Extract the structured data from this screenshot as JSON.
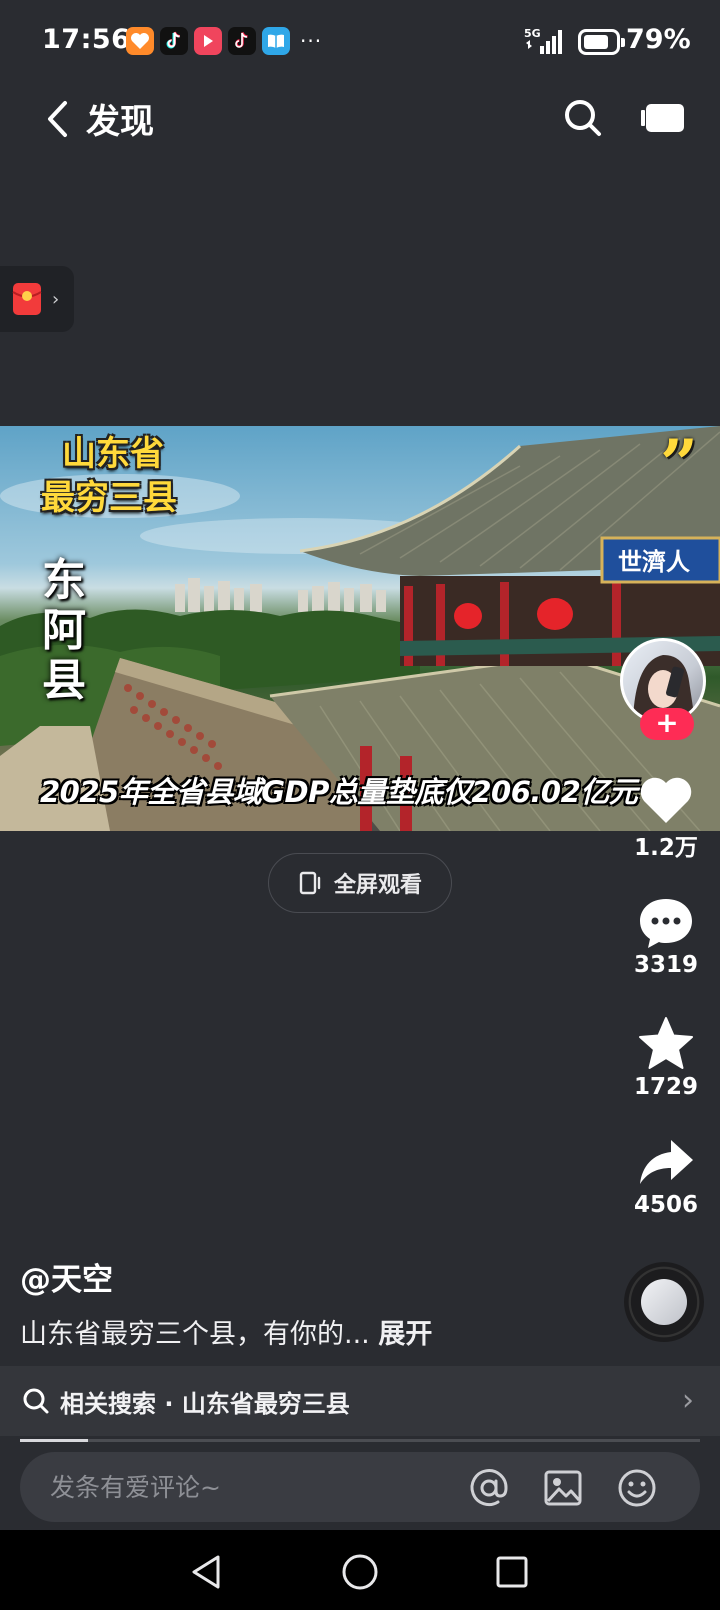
{
  "status_bar": {
    "time": "17:56",
    "network": "5G",
    "battery_percent": "79%",
    "battery_level": 0.79,
    "notification_icons": [
      "xianyu-app-icon",
      "douyin-app-icon",
      "video-app-icon",
      "douyin-lite-app-icon",
      "reader-app-icon"
    ],
    "more": "···"
  },
  "top_nav": {
    "title": "发现"
  },
  "video": {
    "overlay_title_line1": "山东省",
    "overlay_title_line2": "最穷三县",
    "overlay_vertical_text": "东阿县",
    "overlay_caption": "2025年全省县域GDP总量垫底仅206.02亿元",
    "watch_fullscreen": "全屏观看"
  },
  "actions": {
    "likes": "1.2万",
    "comments": "3319",
    "favorites": "1729",
    "shares": "4506",
    "follow": "+"
  },
  "post": {
    "author": "@天空",
    "description": "山东省最穷三个县，有你的...",
    "expand": "展开"
  },
  "related_search": {
    "label": "相关搜索 · 山东省最穷三县"
  },
  "playback": {
    "progress": 0.1
  },
  "comment": {
    "placeholder": "发条有爱评论~"
  },
  "colors": {
    "background": "#2a2c31",
    "accent_red": "#fe2c55",
    "overlay_yellow": "#ffd93b"
  }
}
